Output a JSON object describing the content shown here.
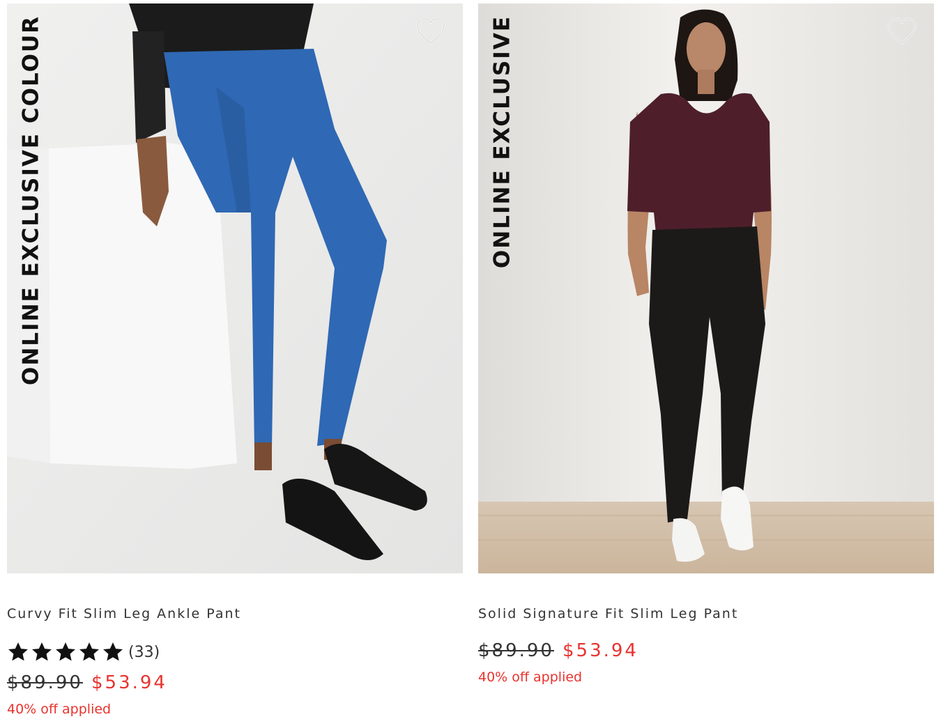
{
  "products": [
    {
      "badge": "ONLINE EXCLUSIVE COLOUR",
      "title": "Curvy Fit Slim Leg Ankle Pant",
      "rating": {
        "stars": 5,
        "count_label": "(33)"
      },
      "original_price": "$89.90",
      "sale_price": "$53.94",
      "discount_label": "40% off applied",
      "image": {
        "subject": "model in blue slim ankle pants and black oxford shoes sitting on white cube",
        "pant_color": "#2f68b4",
        "background_color": "#e9e9e8"
      }
    },
    {
      "badge": "ONLINE EXCLUSIVE",
      "title": "Solid Signature Fit Slim Leg Pant",
      "original_price": "$89.90",
      "sale_price": "$53.94",
      "discount_label": "40% off applied",
      "image": {
        "subject": "model in burgundy top and black slim leg pants with white sneakers",
        "pant_color": "#1c1a18",
        "top_color": "#4e1f2b",
        "background_color": "#ecebe8"
      }
    }
  ],
  "icons": {
    "wishlist": "heart-outline-icon",
    "rating": "star-icon"
  },
  "colors": {
    "sale": "#e8332f",
    "text": "#333333",
    "badge": "#111111"
  }
}
